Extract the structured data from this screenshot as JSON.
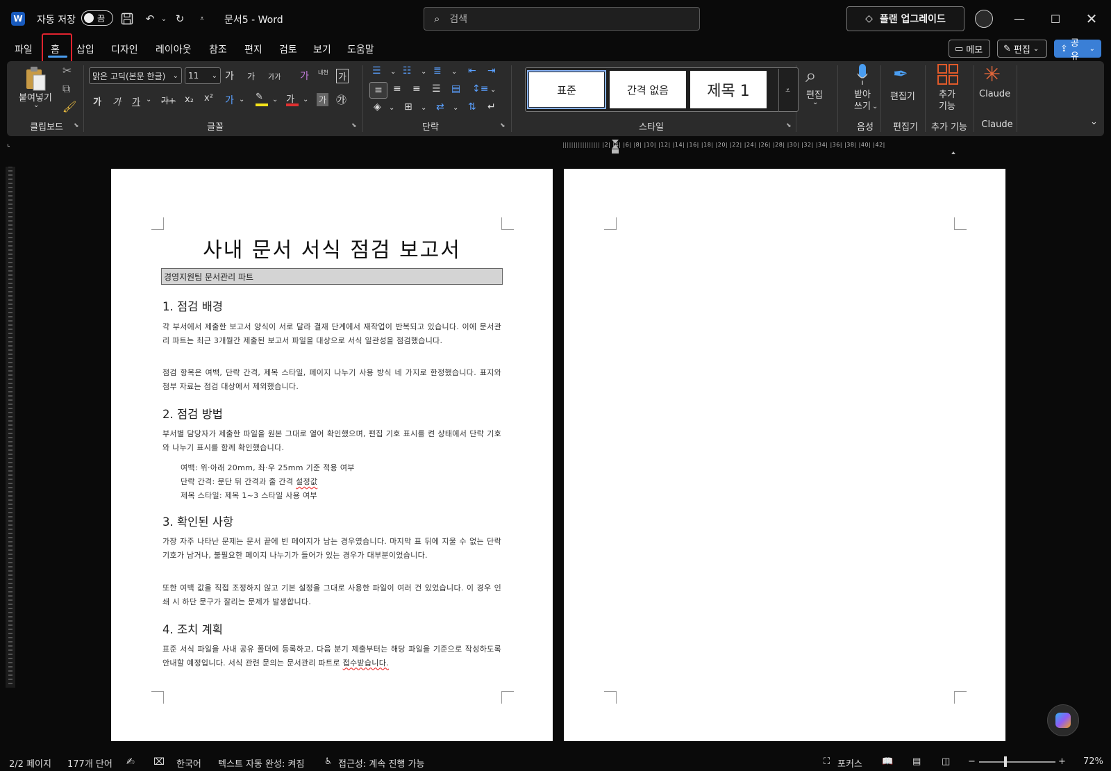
{
  "titlebar": {
    "app_icon": "W",
    "autosave_label": "자동 저장",
    "autosave_state": "끔",
    "doc_title": "문서5  -  Word",
    "search_placeholder": "검색",
    "upgrade_label": "플랜 업그레이드"
  },
  "menu": {
    "items": [
      "파일",
      "홈",
      "삽입",
      "디자인",
      "레이아웃",
      "참조",
      "편지",
      "검토",
      "보기",
      "도움말"
    ],
    "memo_label": "메모",
    "edit_label": "편집",
    "share_label": "공유"
  },
  "ribbon": {
    "clipboard": {
      "paste_label": "붙여넣기",
      "group_label": "클립보드"
    },
    "font": {
      "font_name": "맑은 고딕(본문 한글)",
      "font_size": "11",
      "grow": "가",
      "shrink": "가",
      "case": "가가",
      "clear": "가",
      "phonetic": "내천",
      "border": "가",
      "bold": "가",
      "italic": "가",
      "underline": "가",
      "strike": "가+",
      "sub": "x₂",
      "sup": "x²",
      "effect": "가",
      "font_color": "가",
      "shading": "가",
      "enclose": "㉮",
      "group_label": "글꼴"
    },
    "paragraph": {
      "group_label": "단락"
    },
    "styles": {
      "items": [
        "표준",
        "간격 없음",
        "제목 1"
      ],
      "group_label": "스타일"
    },
    "editing": {
      "label": "편집"
    },
    "dictate": {
      "label": "받아\n쓰기",
      "group_label": "음성"
    },
    "editor": {
      "label": "편집기",
      "group_label": "편집기"
    },
    "addins": {
      "label": "추가\n기능",
      "group_label": "추가 기능"
    },
    "claude": {
      "label": "Claude",
      "group_label": "Claude"
    },
    "accent_colors": {
      "highlight": "#f5e31a",
      "font_color": "#e03030",
      "claude": "#e0663a",
      "addins": "#e05a2a"
    }
  },
  "ruler": {
    "numbers": [
      "2",
      "4",
      "6",
      "8",
      "10",
      "12",
      "14",
      "16",
      "18",
      "20",
      "22",
      "24",
      "26",
      "28",
      "30",
      "32",
      "34",
      "36",
      "38",
      "40",
      "42"
    ]
  },
  "document": {
    "title": "사내 문서 서식 점검 보고서",
    "subtitle": "경영지원팀 문서관리 파트",
    "sections": [
      {
        "heading": "1. 점검 배경",
        "paragraphs": [
          "각 부서에서 제출한 보고서 양식이 서로 달라 결재 단계에서 재작업이 반복되고 있습니다. 이에 문서관리 파트는 최근 3개월간 제출된 보고서 파일을 대상으로 서식 일관성을 점검했습니다.",
          "점검 항목은 여백, 단락 간격, 제목 스타일, 페이지 나누기 사용 방식 네 가지로 한정했습니다. 표지와 첨부 자료는 점검 대상에서 제외했습니다."
        ]
      },
      {
        "heading": "2. 점검 방법",
        "paragraphs": [
          "부서별 담당자가 제출한 파일을 원본 그대로 열어 확인했으며, 편집 기호 표시를 켠 상태에서 단락 기호와 나누기 표시를 함께 확인했습니다."
        ],
        "list": [
          "여백: 위·아래 20mm, 좌·우 25mm 기준 적용 여부",
          "단락 간격: 문단 뒤 간격과 줄 간격 설정값",
          "제목 스타일: 제목 1~3 스타일 사용 여부"
        ]
      },
      {
        "heading": "3. 확인된 사항",
        "paragraphs": [
          "가장 자주 나타난 문제는 문서 끝에 빈 페이지가 남는 경우였습니다. 마지막 표 뒤에 지울 수 없는 단락 기호가 남거나, 불필요한 페이지 나누기가 들어가 있는 경우가 대부분이었습니다.",
          "또한 여백 값을 직접 조정하지 않고 기본 설정을 그대로 사용한 파일이 여러 건 있었습니다. 이 경우 인쇄 시 하단 문구가 잘리는 문제가 발생합니다."
        ]
      },
      {
        "heading": "4. 조치 계획",
        "paragraphs": [
          "표준 서식 파일을 사내 공유 폴더에 등록하고, 다음 분기 제출부터는 해당 파일을 기준으로 작성하도록 안내할 예정입니다. 서식 관련 문의는 문서관리 파트로 접수받습니다."
        ]
      }
    ]
  },
  "status": {
    "page": "2/2 페이지",
    "words": "177개 단어",
    "language": "한국어",
    "autocomplete": "텍스트 자동 완성: 켜짐",
    "accessibility": "접근성: 계속 진행 가능",
    "focus": "포커스",
    "zoom": "72%",
    "zoom_minus": "−",
    "zoom_plus": "+"
  }
}
